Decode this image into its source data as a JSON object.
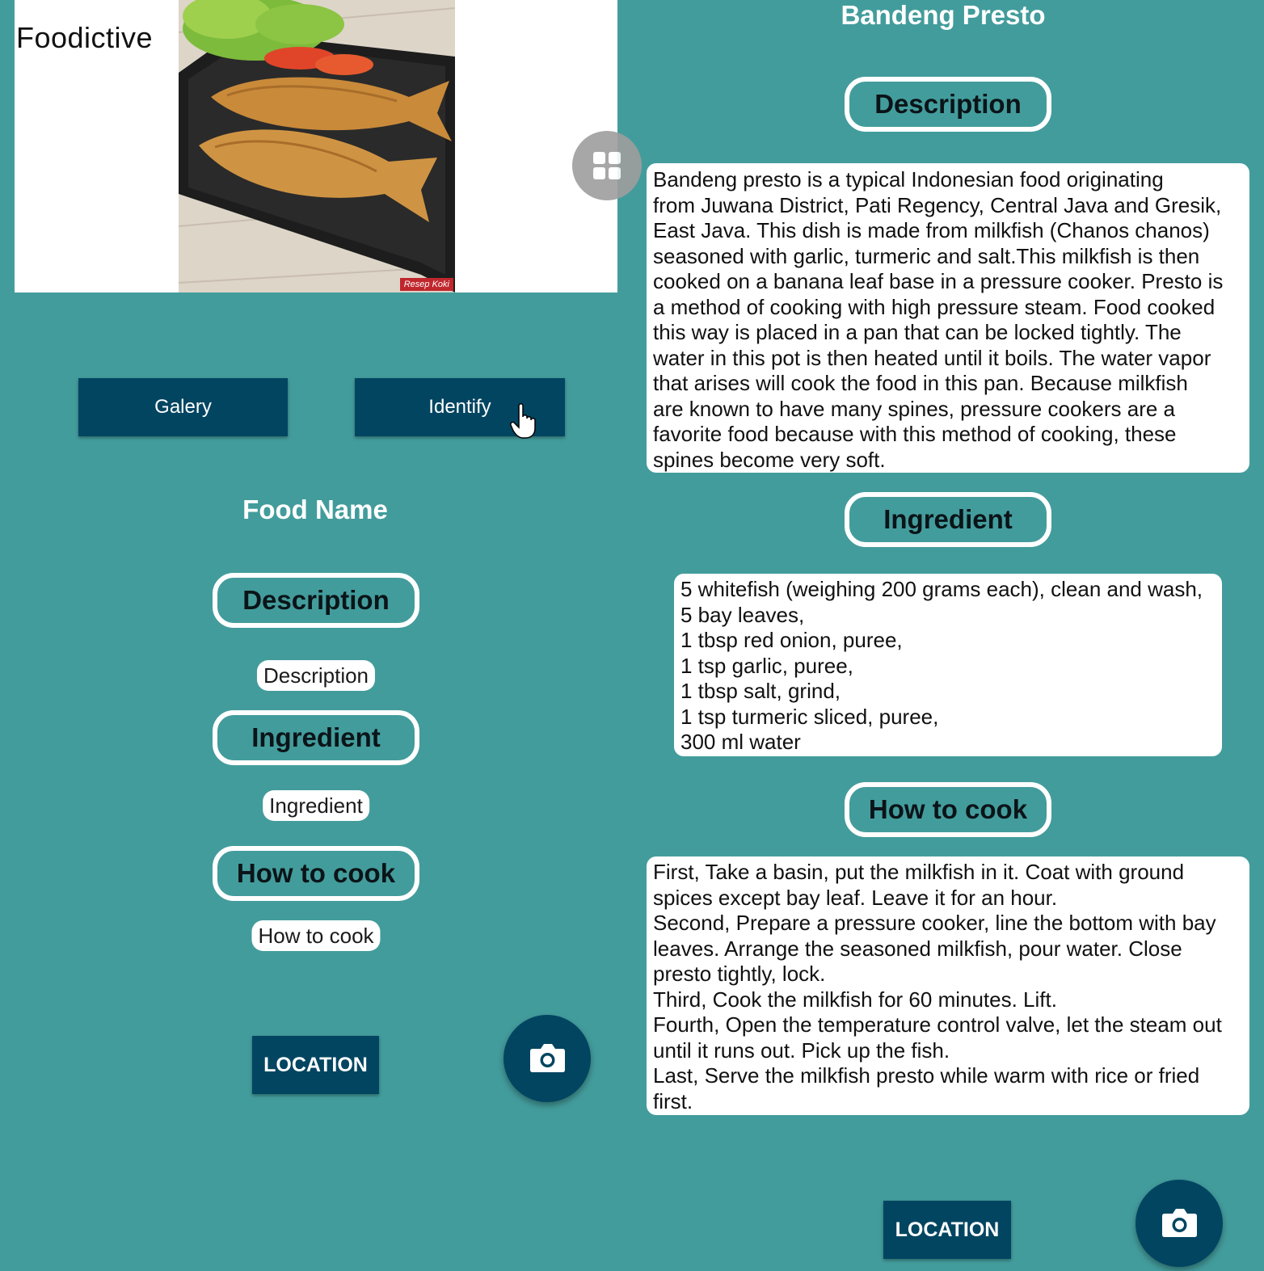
{
  "left_screen": {
    "app_title": "Foodictive",
    "photo_caption": "Resep Koki",
    "buttons": {
      "galery": "Galery",
      "identify": "Identify",
      "location": "LOCATION"
    },
    "food_name": "Food Name",
    "sections": {
      "description_header": "Description",
      "description_value": "Description",
      "ingredient_header": "Ingredient",
      "ingredient_value": "Ingredient",
      "how_to_cook_header": "How to cook",
      "how_to_cook_value": "How to cook"
    },
    "icons": [
      "grid-icon",
      "pointer-hand-icon",
      "camera-icon"
    ]
  },
  "right_screen": {
    "food_name": "Bandeng Presto",
    "description_header": "Description",
    "description_text": "Bandeng presto is a typical Indonesian food originating\nfrom Juwana District, Pati Regency, Central Java and Gresik,\nEast Java. This dish is made from milkfish (Chanos chanos)\nseasoned with garlic, turmeric and salt.This milkfish is then\ncooked on a banana leaf base in a pressure cooker. Presto is\na method of cooking with high pressure steam. Food cooked\nthis way is placed in a pan that can be locked tightly. The\nwater in this pot is then heated until it boils. The water vapor\nthat arises will cook the food in this pan. Because milkfish\nare known to have many spines, pressure cookers are a\nfavorite food because with this method of cooking, these\nspines become very soft.",
    "ingredient_header": "Ingredient",
    "ingredient_text": "5 whitefish (weighing 200 grams each), clean and wash,\n5 bay leaves,\n1 tbsp red onion, puree,\n1 tsp garlic, puree,\n1 tbsp salt, grind,\n1 tsp turmeric sliced, puree,\n300 ml water",
    "how_to_cook_header": "How to cook",
    "how_to_cook_text": "First, Take a basin, put the milkfish in it. Coat with ground\nspices except bay leaf. Leave it for an hour.\nSecond, Prepare a pressure cooker, line the bottom with bay\nleaves. Arrange the seasoned milkfish, pour water. Close\npresto tightly, lock.\nThird, Cook the milkfish for 60 minutes. Lift.\nFourth, Open the temperature control valve, let the steam out\nuntil it runs out. Pick up the fish.\nLast, Serve the milkfish presto while warm with rice or fried\nfirst.",
    "location_button": "LOCATION"
  },
  "colors": {
    "background": "#439c9c",
    "button": "#024561",
    "card": "#ffffff",
    "fab_grid": "#9e9e9e"
  }
}
